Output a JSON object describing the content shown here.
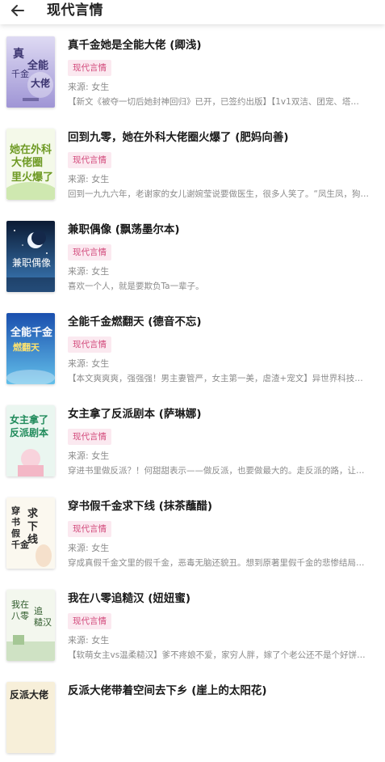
{
  "header": {
    "title": "现代言情",
    "back_icon": "arrow-left-icon"
  },
  "colors": {
    "tag_bg": "#fbe9f0",
    "tag_text": "#d2487a",
    "meta_text": "#8b8b8b"
  },
  "books": [
    {
      "title": "真千金她是全能大佬 (卿浅)",
      "tag": "现代言情",
      "source": "来源: 女生",
      "intro": "【新文《被夺一切后她封神回归》已开，已签约出版】【1v1双洁、团宠、塔…",
      "cover_text": "真千金全能大佬",
      "cover_colors": [
        "#d9d7f2",
        "#a79fd8"
      ]
    },
    {
      "title": "回到九零，她在外科大佬圈火爆了 (肥妈向善)",
      "tag": "现代言情",
      "source": "来源: 女生",
      "intro": "回到一九九六年，老谢家的女儿谢婉莹说要做医生，很多人笑了。“凤生凤，狗…",
      "cover_text": "她在外科大佬圈里火爆了",
      "cover_colors": [
        "#f4f9e9",
        "#cfe8b0"
      ]
    },
    {
      "title": "兼职偶像 (飘荡墨尔本)",
      "tag": "现代言情",
      "source": "来源: 女生",
      "intro": "喜欢一个人，就是要欺负Ta一辈子。",
      "cover_text": "兼职偶像",
      "cover_colors": [
        "#0d1f3a",
        "#3a7ab8"
      ]
    },
    {
      "title": "全能千金燃翻天 (德音不忘)",
      "tag": "现代言情",
      "source": "来源: 女生",
      "intro": "【本文爽爽爽，强强强！男主妻管严，女主第一美，虐渣+宠文】异世界科技…",
      "cover_text": "全能千金燃翻天",
      "cover_colors": [
        "#1a4fae",
        "#5ab4e6"
      ]
    },
    {
      "title": "女主拿了反派剧本 (萨琳娜)",
      "tag": "现代言情",
      "source": "来源: 女生",
      "intro": "穿进书里做反派？！何甜甜表示——做反派，也要做最大的。走反派的路，让…",
      "cover_text": "女主拿了反派剧本",
      "cover_colors": [
        "#eaf6f0",
        "#bfe3d3"
      ]
    },
    {
      "title": "穿书假千金求下线 (抹茶蘸醋)",
      "tag": "现代言情",
      "source": "来源: 女生",
      "intro": "穿成真假千金文里的假千金，恶毒无脑还貌丑。想到原著里假千金的悲惨结局…",
      "cover_text": "穿书假千金求下线",
      "cover_colors": [
        "#fbf8ef",
        "#eae2c8"
      ]
    },
    {
      "title": "我在八零追糙汉 (妞妞蜜)",
      "tag": "现代言情",
      "source": "来源: 女生",
      "intro": "【软萌女主vs温柔糙汉】爹不疼娘不爱，家穷人胖，嫁了个老公还不是个好饼…",
      "cover_text": "我在八零追糙汉",
      "cover_colors": [
        "#f3f7ee",
        "#cfe2c4"
      ]
    },
    {
      "title": "反派大佬带着空间去下乡 (崖上的太阳花)",
      "tag": "",
      "source": "",
      "intro": "",
      "cover_text": "反派大佬",
      "cover_colors": [
        "#f7efd9",
        "#e6cf99"
      ]
    }
  ]
}
